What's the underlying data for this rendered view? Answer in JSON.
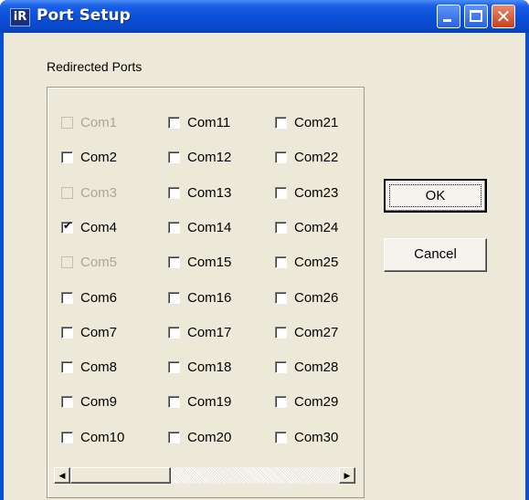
{
  "window": {
    "title": "Port Setup",
    "app_icon_glyph": "iR",
    "controls": [
      "minimize-icon",
      "maximize-icon",
      "close-icon"
    ],
    "close_glyph": "✕",
    "colors": {
      "titlebar": "#0b4fd8",
      "client": "#ece9d8"
    }
  },
  "group": {
    "label": "Redirected Ports",
    "columns": [
      [
        {
          "label": "Com1",
          "checked": false,
          "enabled": false
        },
        {
          "label": "Com2",
          "checked": false,
          "enabled": true
        },
        {
          "label": "Com3",
          "checked": false,
          "enabled": false
        },
        {
          "label": "Com4",
          "checked": true,
          "enabled": true
        },
        {
          "label": "Com5",
          "checked": false,
          "enabled": false
        },
        {
          "label": "Com6",
          "checked": false,
          "enabled": true
        },
        {
          "label": "Com7",
          "checked": false,
          "enabled": true
        },
        {
          "label": "Com8",
          "checked": false,
          "enabled": true
        },
        {
          "label": "Com9",
          "checked": false,
          "enabled": true
        },
        {
          "label": "Com10",
          "checked": false,
          "enabled": true
        }
      ],
      [
        {
          "label": "Com11",
          "checked": false,
          "enabled": true
        },
        {
          "label": "Com12",
          "checked": false,
          "enabled": true
        },
        {
          "label": "Com13",
          "checked": false,
          "enabled": true
        },
        {
          "label": "Com14",
          "checked": false,
          "enabled": true
        },
        {
          "label": "Com15",
          "checked": false,
          "enabled": true
        },
        {
          "label": "Com16",
          "checked": false,
          "enabled": true
        },
        {
          "label": "Com17",
          "checked": false,
          "enabled": true
        },
        {
          "label": "Com18",
          "checked": false,
          "enabled": true
        },
        {
          "label": "Com19",
          "checked": false,
          "enabled": true
        },
        {
          "label": "Com20",
          "checked": false,
          "enabled": true
        }
      ],
      [
        {
          "label": "Com21",
          "checked": false,
          "enabled": true
        },
        {
          "label": "Com22",
          "checked": false,
          "enabled": true
        },
        {
          "label": "Com23",
          "checked": false,
          "enabled": true
        },
        {
          "label": "Com24",
          "checked": false,
          "enabled": true
        },
        {
          "label": "Com25",
          "checked": false,
          "enabled": true
        },
        {
          "label": "Com26",
          "checked": false,
          "enabled": true
        },
        {
          "label": "Com27",
          "checked": false,
          "enabled": true
        },
        {
          "label": "Com28",
          "checked": false,
          "enabled": true
        },
        {
          "label": "Com29",
          "checked": false,
          "enabled": true
        },
        {
          "label": "Com30",
          "checked": false,
          "enabled": true
        }
      ]
    ]
  },
  "scrollbar": {
    "left_arrow_icon": "◀",
    "right_arrow_icon": "▶",
    "position": 0
  },
  "buttons": {
    "ok_label": "OK",
    "cancel_label": "Cancel"
  }
}
